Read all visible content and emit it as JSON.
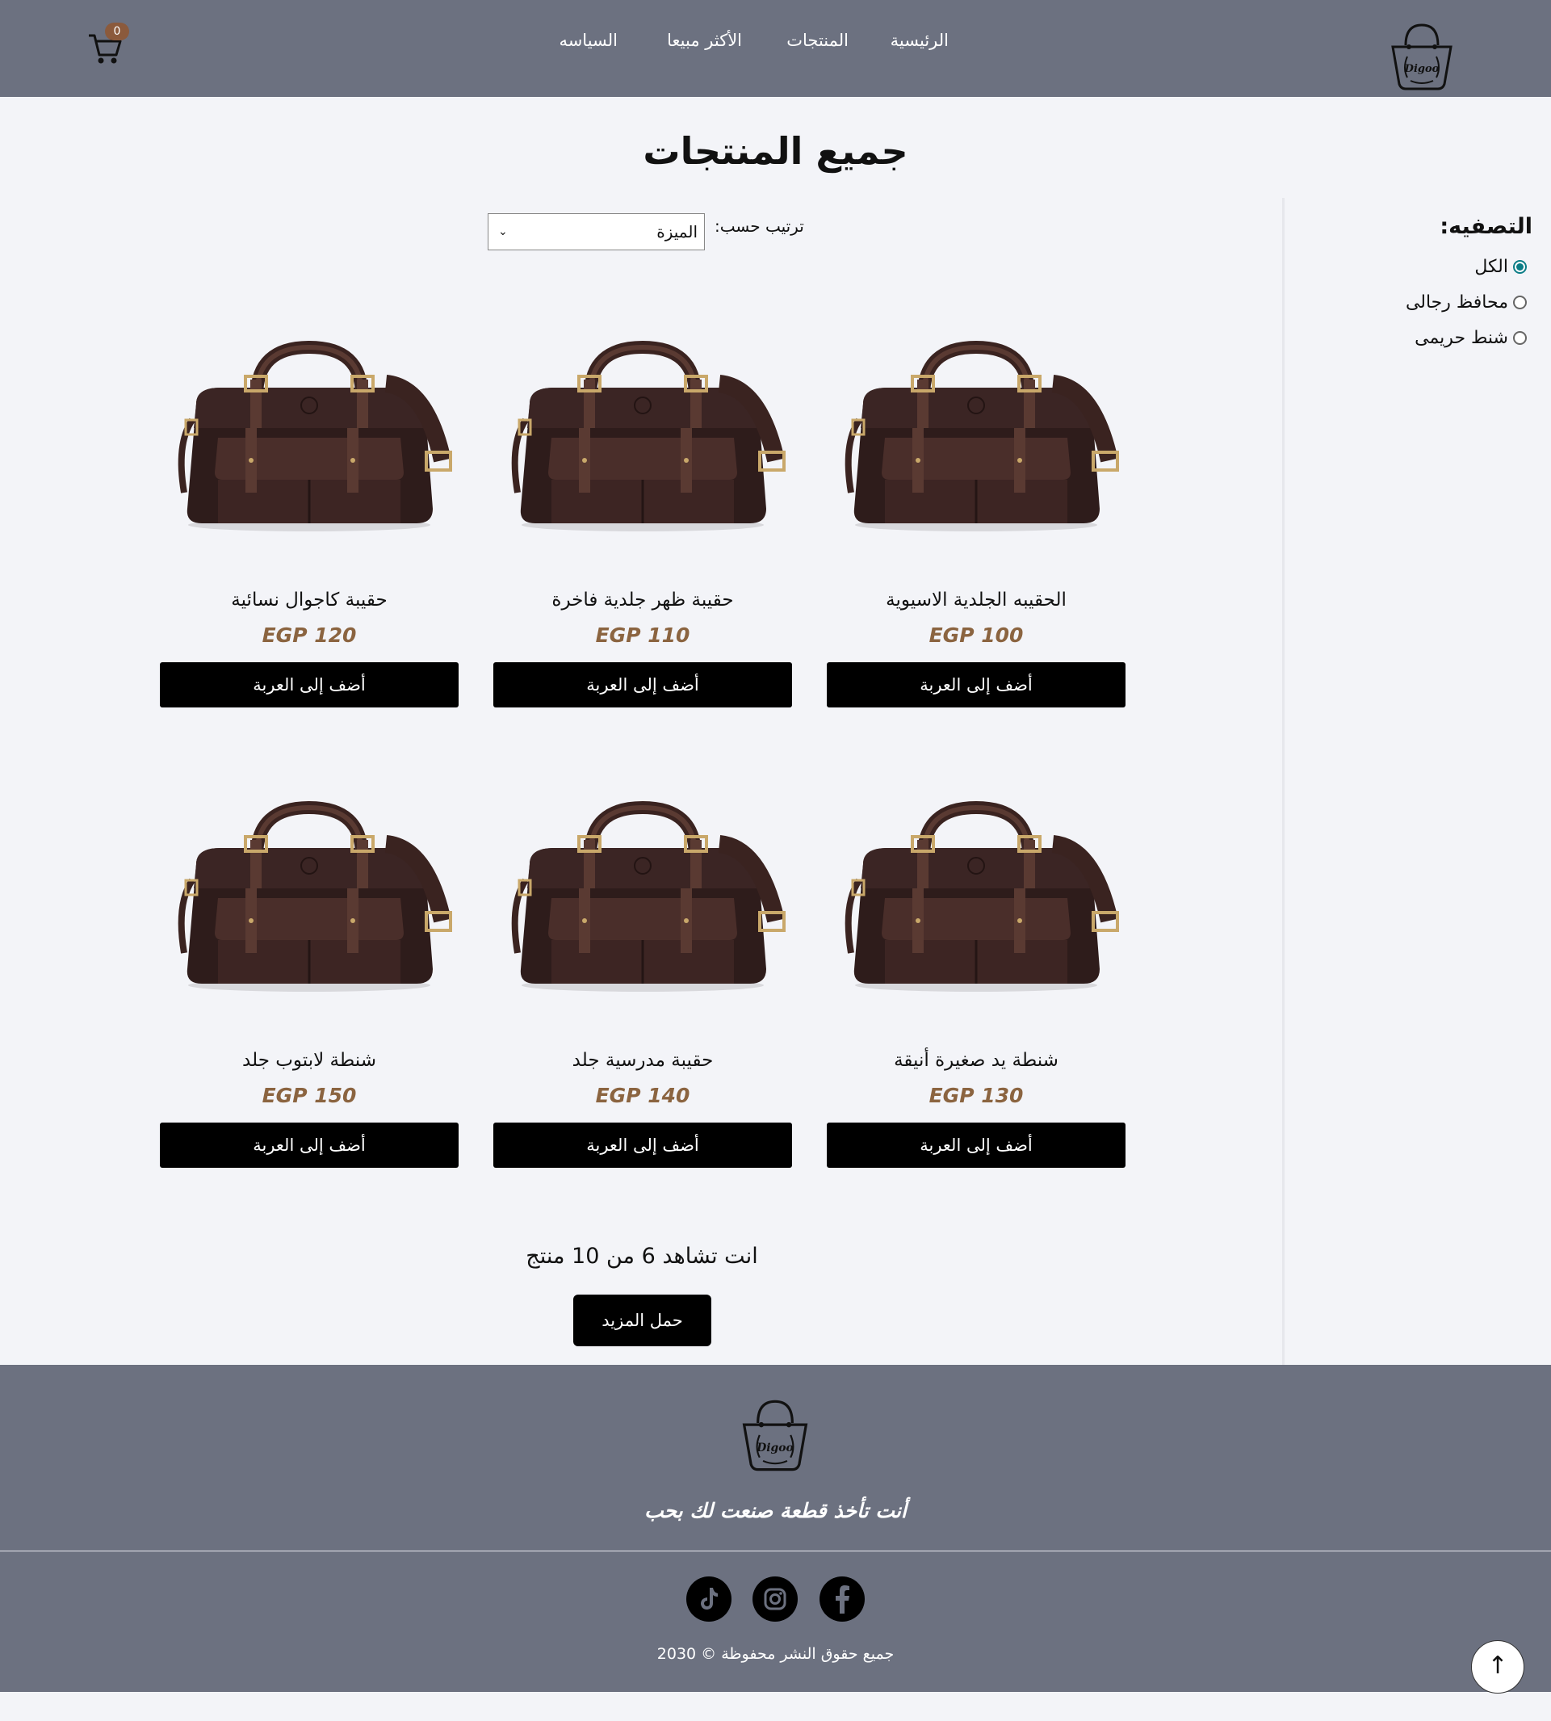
{
  "header": {
    "nav": [
      {
        "label": "الرئيسية"
      },
      {
        "label": "المنتجات"
      },
      {
        "label": "الأكثر مبيعا"
      },
      {
        "label": "السياسه"
      }
    ],
    "cart_count": "0",
    "logo_text": "Digoo"
  },
  "main": {
    "title": "جميع المنتجات",
    "sort_label": "ترتيب حسب:",
    "sort_selected": "الميزة",
    "viewing": "انت تشاهد 6 من 10 منتج",
    "load_more": "حمل المزيد"
  },
  "filter": {
    "title": "التصفيه:",
    "options": [
      {
        "label": "الكل",
        "checked": true
      },
      {
        "label": "محافظ رجالى",
        "checked": false
      },
      {
        "label": "شنط حريمى",
        "checked": false
      }
    ]
  },
  "products": [
    {
      "name": "الحقيبه الجلدية الاسيوية",
      "price": "EGP 100",
      "button": "أضف إلى العربة"
    },
    {
      "name": "حقيبة ظهر جلدية فاخرة",
      "price": "EGP 110",
      "button": "أضف إلى العربة"
    },
    {
      "name": "حقيبة كاجوال نسائية",
      "price": "EGP 120",
      "button": "أضف إلى العربة"
    },
    {
      "name": "شنطة يد صغيرة أنيقة",
      "price": "EGP 130",
      "button": "أضف إلى العربة"
    },
    {
      "name": "حقيبة مدرسية جلد",
      "price": "EGP 140",
      "button": "أضف إلى العربة"
    },
    {
      "name": "شنطة لابتوب جلد",
      "price": "EGP 150",
      "button": "أضف إلى العربة"
    }
  ],
  "footer": {
    "tagline": "أنت تأخذ قطعة صنعت لك بحب",
    "copyright": "جميع حقوق النشر محفوظة © 2030",
    "social": [
      "facebook-icon",
      "instagram-icon",
      "tiktok-icon"
    ]
  },
  "colors": {
    "header_bg": "#6c7180",
    "page_bg": "#f3f4f8",
    "price": "#8b6440",
    "accent_radio": "#0a7c86",
    "button_bg": "#000000"
  }
}
